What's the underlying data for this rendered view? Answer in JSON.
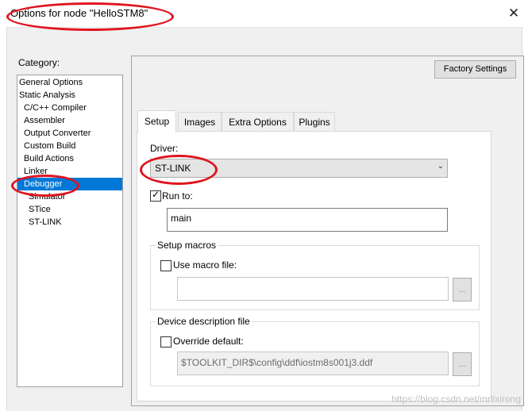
{
  "window": {
    "title": "Options for node \"HelloSTM8\"",
    "close_glyph": "✕"
  },
  "category": {
    "label": "Category:",
    "items": [
      {
        "label": "General Options",
        "indent": false,
        "selected": false
      },
      {
        "label": "Static Analysis",
        "indent": false,
        "selected": false
      },
      {
        "label": "C/C++ Compiler",
        "indent": true,
        "selected": false
      },
      {
        "label": "Assembler",
        "indent": true,
        "selected": false
      },
      {
        "label": "Output Converter",
        "indent": true,
        "selected": false
      },
      {
        "label": "Custom Build",
        "indent": true,
        "selected": false
      },
      {
        "label": "Build Actions",
        "indent": true,
        "selected": false
      },
      {
        "label": "Linker",
        "indent": true,
        "selected": false
      },
      {
        "label": "Debugger",
        "indent": true,
        "selected": true
      },
      {
        "label": "Simulator",
        "indent": "double",
        "selected": false
      },
      {
        "label": "STice",
        "indent": "double",
        "selected": false
      },
      {
        "label": "ST-LINK",
        "indent": "double",
        "selected": false
      }
    ]
  },
  "factory_settings_label": "Factory Settings",
  "tabs": [
    "Setup",
    "Images",
    "Extra Options",
    "Plugins"
  ],
  "setup": {
    "driver_label": "Driver:",
    "driver_value": "ST-LINK",
    "run_to_label": "Run to:",
    "run_to_checked": true,
    "run_to_value": "main",
    "macros_group": "Setup macros",
    "use_macro_label": "Use macro file:",
    "use_macro_checked": false,
    "macro_file_value": "",
    "browse_label": "...",
    "ddf_group": "Device description file",
    "override_label": "Override default:",
    "override_checked": false,
    "ddf_value": "$TOOLKIT_DIR$\\config\\ddf\\iostm8s001j3.ddf"
  },
  "watermark": "https://blog.csdn.net/mrlixirong",
  "colors": {
    "selection": "#0078d7",
    "annotation_red": "#e0141e"
  }
}
